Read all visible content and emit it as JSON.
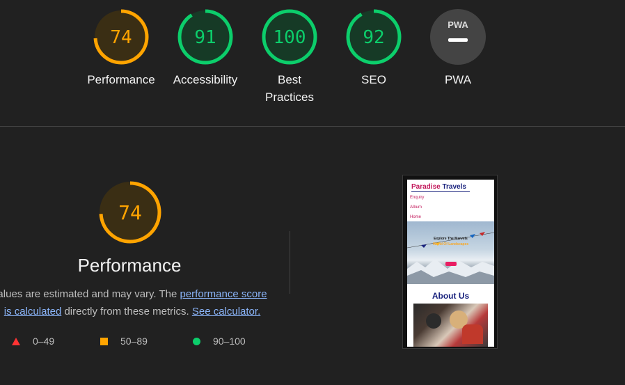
{
  "categories": [
    {
      "score": "74",
      "label": [
        "Performance"
      ],
      "color": "#ffa400",
      "bg": "#3a2e14",
      "fraction": 0.74
    },
    {
      "score": "91",
      "label": [
        "Accessibility"
      ],
      "color": "#0cce6b",
      "bg": "#163a26",
      "fraction": 0.91
    },
    {
      "score": "100",
      "label": [
        "Best",
        "Practices"
      ],
      "color": "#0cce6b",
      "bg": "#163a26",
      "fraction": 1.0
    },
    {
      "score": "92",
      "label": [
        "SEO"
      ],
      "color": "#0cce6b",
      "bg": "#163a26",
      "fraction": 0.92
    },
    {
      "pwa_text": "PWA",
      "label": [
        "PWA"
      ],
      "bg": "#444444"
    }
  ],
  "performance": {
    "score": "74",
    "fraction": 0.74,
    "title": "Performance",
    "desc_prefix": "alues are estimated and may vary. The ",
    "link_score_1": "performance score",
    "link_score_2": "is calculated",
    "desc_middle": " directly from these metrics. ",
    "link_calc": "See calculator."
  },
  "legend": [
    {
      "range": "0–49",
      "shape": "triangle",
      "color": "#ff3333"
    },
    {
      "range": "50–89",
      "shape": "square",
      "color": "#ffa400"
    },
    {
      "range": "90–100",
      "shape": "circle",
      "color": "#0cce6b"
    }
  ],
  "screenshot": {
    "logo_part1": "Paradise",
    "logo_part2": " Travels",
    "nav": [
      "Enquiry",
      "Album",
      "Home"
    ],
    "hero_line1": "Explore The Marvels",
    "hero_line2": "World Of Landscapes",
    "about": "About Us"
  }
}
